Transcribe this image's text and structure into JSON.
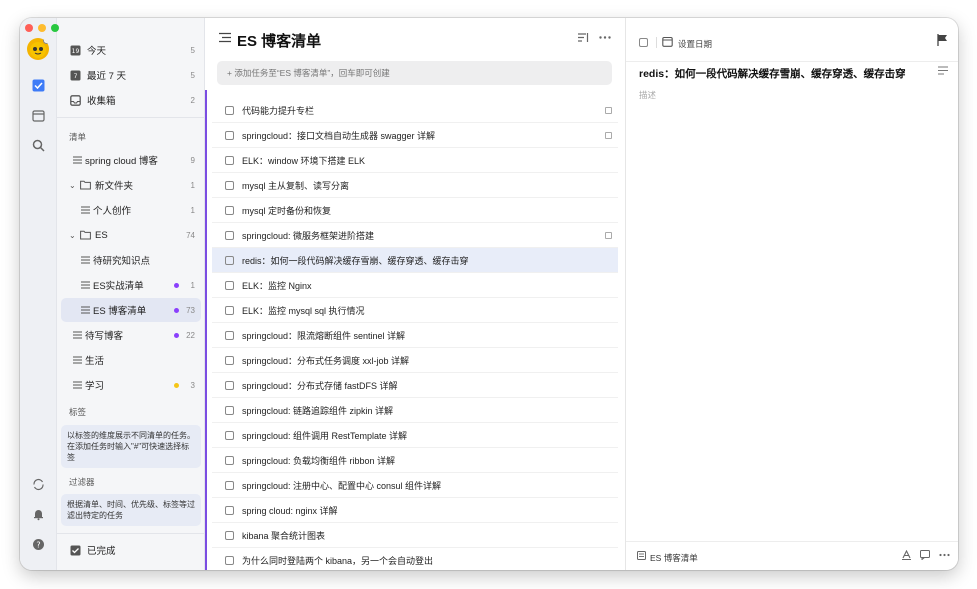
{
  "window": {
    "traffic": [
      "#ff5f57",
      "#febc2e",
      "#28c840"
    ]
  },
  "rail": {
    "icons": [
      "avatar-icon",
      "check-icon",
      "calendar-icon",
      "search-icon",
      "sync-icon",
      "bell-icon",
      "help-icon"
    ]
  },
  "sidebar": {
    "smart": [
      {
        "icon": "19",
        "label": "今天",
        "count": "5"
      },
      {
        "icon": "7",
        "label": "最近 7 天",
        "count": "5"
      },
      {
        "icon": "☐",
        "label": "收集箱",
        "count": "2"
      }
    ],
    "lists_label": "清单",
    "lists": [
      {
        "label": "spring cloud 博客",
        "count": "9",
        "indent": 0,
        "icon": "≡"
      },
      {
        "label": "新文件夹",
        "count": "1",
        "indent": 0,
        "icon": "▭",
        "folder": true
      },
      {
        "label": "个人创作",
        "count": "1",
        "indent": 1,
        "icon": "≡"
      },
      {
        "label": "ES",
        "count": "74",
        "indent": 0,
        "icon": "▭",
        "folder": true
      },
      {
        "label": "待研究知识点",
        "count": "",
        "indent": 1,
        "icon": "≡"
      },
      {
        "label": "ES实战清单",
        "count": "1",
        "indent": 1,
        "icon": "≡",
        "dot": "#8a3ffc"
      },
      {
        "label": "ES 博客清单",
        "count": "73",
        "indent": 1,
        "icon": "≡",
        "dot": "#8a3ffc",
        "active": true
      },
      {
        "label": "待写博客",
        "count": "22",
        "indent": 0,
        "icon": "≡",
        "dot": "#8a3ffc"
      },
      {
        "label": "生活",
        "count": "",
        "indent": 0,
        "icon": "≡"
      },
      {
        "label": "学习",
        "count": "3",
        "indent": 0,
        "icon": "≡",
        "dot": "#f5c518"
      }
    ],
    "tags_label": "标签",
    "tags_tip": "以标签的维度展示不同清单的任务。在添加任务时输入\"#\"可快速选择标签",
    "filters_label": "过滤器",
    "filters_tip": "根据清单、时间、优先级、标签等过滤出特定的任务",
    "completed_label": "已完成"
  },
  "list": {
    "title": "ES 博客清单",
    "add_placeholder": "+ 添加任务至“ES 博客清单”，回车即可创建",
    "tasks": [
      {
        "text": "代码能力提升专栏",
        "note": true
      },
      {
        "text": "springcloud：接口文档自动生成器 swagger 详解",
        "note": true
      },
      {
        "text": "ELK：window 环境下搭建 ELK",
        "note": false
      },
      {
        "text": "mysql 主从复制、读写分离",
        "note": false
      },
      {
        "text": "mysql 定时备份和恢复",
        "note": false
      },
      {
        "text": "springcloud: 微服务框架进阶搭建",
        "note": true
      },
      {
        "text": "redis：如何一段代码解决缓存雪崩、缓存穿透、缓存击穿",
        "note": false,
        "selected": true
      },
      {
        "text": "ELK：监控 Nginx",
        "note": false
      },
      {
        "text": "ELK：监控 mysql sql 执行情况",
        "note": false
      },
      {
        "text": "springcloud：限流熔断组件 sentinel 详解",
        "note": false
      },
      {
        "text": "springcloud：分布式任务调度 xxl-job 详解",
        "note": false
      },
      {
        "text": "springcloud：分布式存储 fastDFS 详解",
        "note": false
      },
      {
        "text": "springcloud: 链路追踪组件 zipkin 详解",
        "note": false
      },
      {
        "text": "springcloud: 组件调用 RestTemplate 详解",
        "note": false
      },
      {
        "text": "springcloud: 负载均衡组件 ribbon 详解",
        "note": false
      },
      {
        "text": "springcloud: 注册中心、配置中心 consul 组件详解",
        "note": false
      },
      {
        "text": "spring cloud: nginx 详解",
        "note": false
      },
      {
        "text": "kibana 聚合统计图表",
        "note": false
      },
      {
        "text": "为什么同时登陆两个 kibana，另一个会自动登出",
        "note": false
      }
    ]
  },
  "detail": {
    "date_label": "设置日期",
    "title": "redis：如何一段代码解决缓存雪崩、缓存穿透、缓存击穿",
    "desc_placeholder": "描述",
    "footer_list": "ES 博客清单"
  }
}
